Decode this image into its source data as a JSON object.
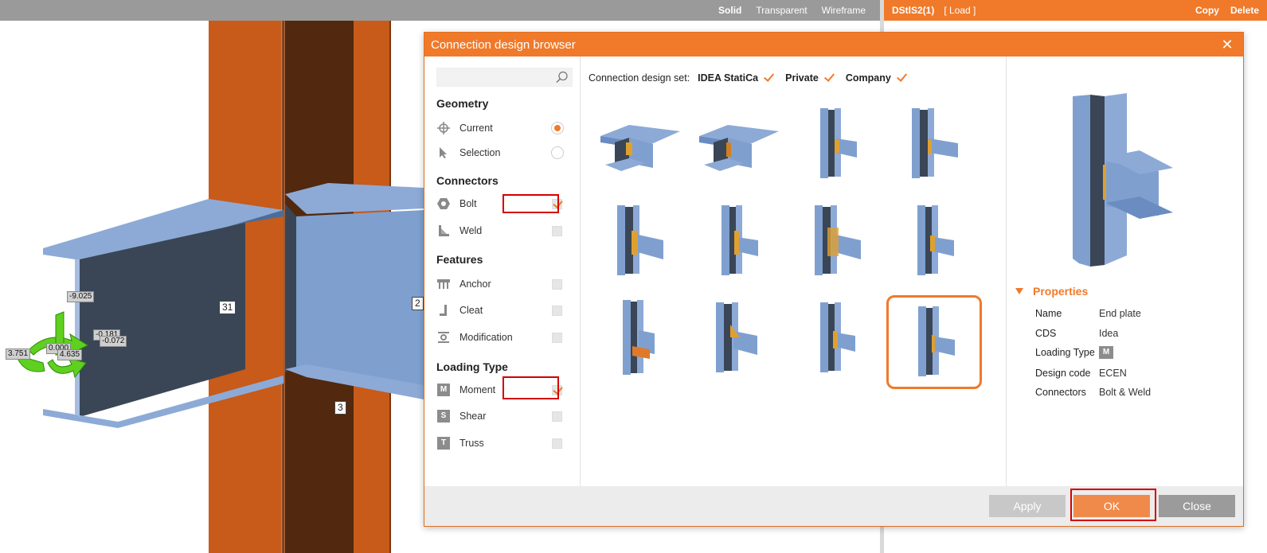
{
  "viewport": {
    "view_modes": [
      "Solid",
      "Transparent",
      "Wireframe"
    ],
    "active_view_mode": "Solid",
    "member_labels": [
      "31",
      "2",
      "3"
    ],
    "force_labels": [
      "-9.025",
      "-0.181",
      "-0.072",
      "3.751",
      "0.000",
      "4.635"
    ]
  },
  "connection_bar": {
    "name": "DStlS2(1)",
    "load": "[ Load ]",
    "copy": "Copy",
    "delete": "Delete"
  },
  "dialog": {
    "title": "Connection design browser",
    "close_icon": "close-icon",
    "search": {
      "placeholder": "",
      "value": ""
    },
    "sections": {
      "geometry": "Geometry",
      "connectors": "Connectors",
      "features": "Features",
      "loading_type": "Loading Type"
    },
    "geometry_options": [
      {
        "label": "Current",
        "selected": true,
        "icon": "crosshair-icon"
      },
      {
        "label": "Selection",
        "selected": false,
        "icon": "cursor-icon"
      }
    ],
    "connectors": [
      {
        "label": "Bolt",
        "checked": true,
        "icon": "bolt-icon"
      },
      {
        "label": "Weld",
        "checked": false,
        "icon": "weld-icon"
      }
    ],
    "features": [
      {
        "label": "Anchor",
        "checked": false,
        "icon": "anchor-icon"
      },
      {
        "label": "Cleat",
        "checked": false,
        "icon": "cleat-icon"
      },
      {
        "label": "Modification",
        "checked": false,
        "icon": "modification-icon"
      }
    ],
    "loading_types": [
      {
        "label": "Moment",
        "checked": true,
        "letter": "M"
      },
      {
        "label": "Shear",
        "checked": false,
        "letter": "S"
      },
      {
        "label": "Truss",
        "checked": false,
        "letter": "T"
      }
    ],
    "design_set": {
      "label": "Connection design set:",
      "options": [
        {
          "label": "IDEA StatiCa",
          "checked": true
        },
        {
          "label": "Private",
          "checked": true
        },
        {
          "label": "Company",
          "checked": true
        }
      ]
    },
    "thumbnails_count": 12,
    "selected_thumbnail": 12,
    "properties": {
      "header": "Properties",
      "rows": [
        {
          "key": "Name",
          "value": "End plate"
        },
        {
          "key": "CDS",
          "value": "Idea"
        },
        {
          "key": "Loading Type",
          "value": "M"
        },
        {
          "key": "Design code",
          "value": "ECEN"
        },
        {
          "key": "Connectors",
          "value": "Bolt & Weld"
        }
      ]
    },
    "buttons": {
      "apply": "Apply",
      "ok": "OK",
      "close": "Close"
    }
  },
  "colors": {
    "accent": "#f07a2a",
    "steel": "#7fa0cf",
    "steel_dark": "#3a4656",
    "column": "#c85a1a",
    "column_dark": "#52280e",
    "highlight_red": "#d40000"
  }
}
